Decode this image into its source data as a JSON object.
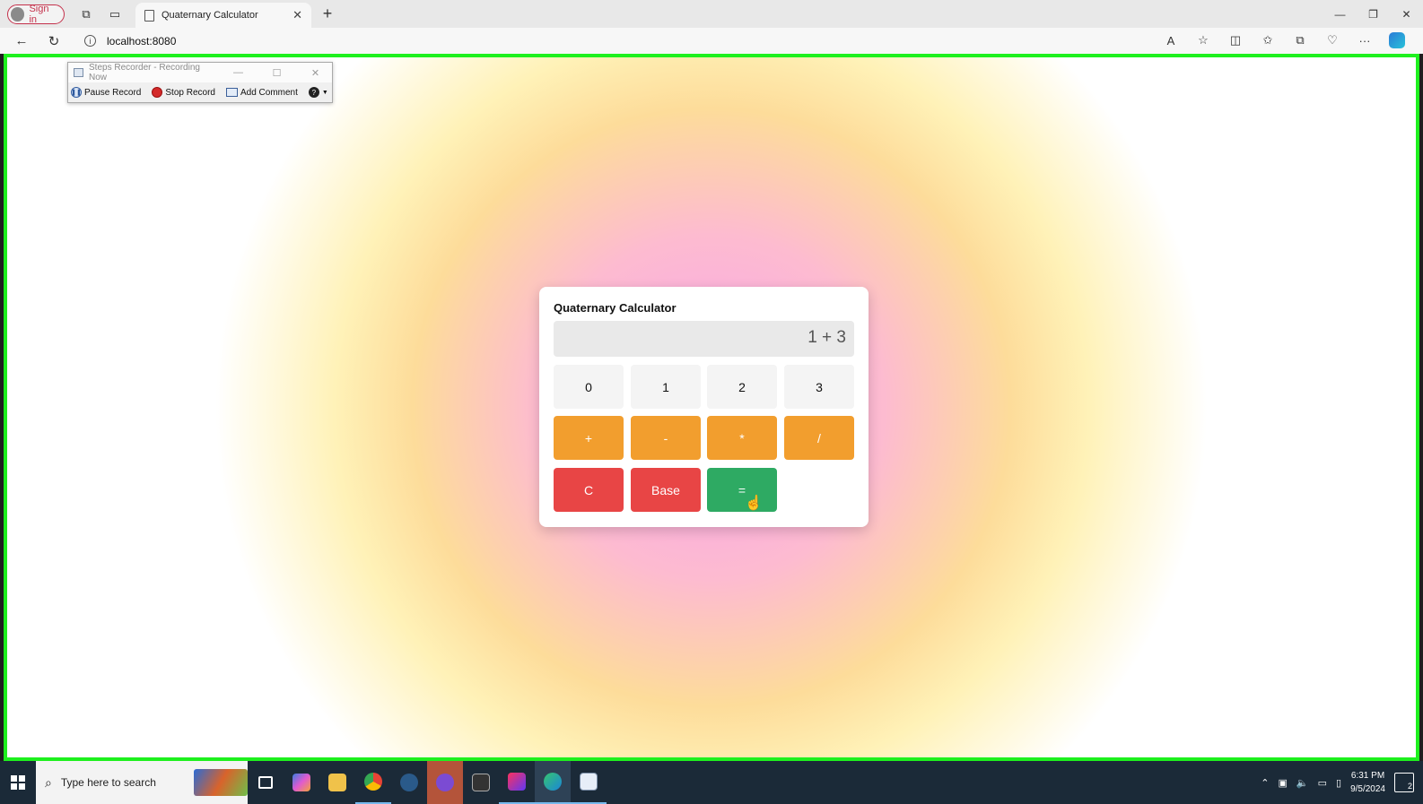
{
  "browser": {
    "signin_label": "Sign in",
    "tab_title": "Quaternary Calculator",
    "tab_close": "✕",
    "new_tab": "+",
    "url": "localhost:8080",
    "win_minimize": "—",
    "win_restore": "❐",
    "win_close": "✕"
  },
  "steps_recorder": {
    "title": "Steps Recorder - Recording Now",
    "pause_label": "Pause Record",
    "stop_label": "Stop Record",
    "comment_label": "Add Comment",
    "help_label": "?"
  },
  "calculator": {
    "title": "Quaternary Calculator",
    "display": "1 + 3",
    "digits": [
      "0",
      "1",
      "2",
      "3"
    ],
    "operators": [
      "+",
      "-",
      "*",
      "/"
    ],
    "clear_label": "C",
    "base_label": "Base",
    "equals_label": "="
  },
  "taskbar": {
    "search_placeholder": "Type here to search",
    "time": "6:31 PM",
    "date": "9/5/2024",
    "notification_count": "2"
  },
  "colors": {
    "viewport_border": "#1ef01e",
    "operator": "#f29e2e",
    "clear_red": "#e84545",
    "equals_green": "#2eaa63"
  }
}
